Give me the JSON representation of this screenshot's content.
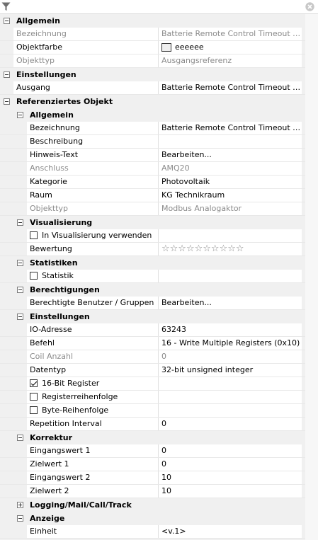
{
  "toolbar": {
    "filter_icon": "filter-icon",
    "clear_icon": "clear-icon"
  },
  "rows": [
    {
      "t": "sec",
      "level": 0,
      "name": "Allgemein"
    },
    {
      "t": "prop",
      "level": 0,
      "name": "Bezeichnung",
      "value": "Batterie Remote Control Timeout Ausgang",
      "disabled": true
    },
    {
      "t": "prop",
      "level": 0,
      "name": "Objektfarbe",
      "value": "eeeeee",
      "color": "#eeeeee"
    },
    {
      "t": "prop",
      "level": 0,
      "name": "Objekttyp",
      "value": "Ausgangsreferenz",
      "disabled": true
    },
    {
      "t": "sec",
      "level": 0,
      "name": "Einstellungen"
    },
    {
      "t": "prop",
      "level": 0,
      "name": "Ausgang",
      "value": "Batterie Remote Control Timeout Ausgang"
    },
    {
      "t": "sec",
      "level": 0,
      "name": "Referenziertes Objekt"
    },
    {
      "t": "sec",
      "level": 1,
      "name": "Allgemein"
    },
    {
      "t": "prop",
      "level": 1,
      "name": "Bezeichnung",
      "value": "Batterie Remote Control Timeout Ausgang"
    },
    {
      "t": "prop",
      "level": 1,
      "name": "Beschreibung",
      "value": ""
    },
    {
      "t": "prop",
      "level": 1,
      "name": "Hinweis-Text",
      "value": "Bearbeiten..."
    },
    {
      "t": "prop",
      "level": 1,
      "name": "Anschluss",
      "value": "AMQ20",
      "disabled": true
    },
    {
      "t": "prop",
      "level": 1,
      "name": "Kategorie",
      "value": "Photovoltaik"
    },
    {
      "t": "prop",
      "level": 1,
      "name": "Raum",
      "value": "KG Technikraum"
    },
    {
      "t": "prop",
      "level": 1,
      "name": "Objekttyp",
      "value": "Modbus Analogaktor",
      "disabled": true
    },
    {
      "t": "sec",
      "level": 1,
      "name": "Visualisierung"
    },
    {
      "t": "prop",
      "level": 1,
      "name": "In Visualisierung verwenden",
      "value": "",
      "checkbox": false
    },
    {
      "t": "prop",
      "level": 1,
      "name": "Bewertung",
      "value": "☆☆☆☆☆☆☆☆☆☆",
      "stars": true
    },
    {
      "t": "sec",
      "level": 1,
      "name": "Statistiken"
    },
    {
      "t": "prop",
      "level": 1,
      "name": "Statistik",
      "value": "",
      "checkbox": false
    },
    {
      "t": "sec",
      "level": 1,
      "name": "Berechtigungen"
    },
    {
      "t": "prop",
      "level": 1,
      "name": "Berechtigte Benutzer / Gruppen",
      "value": "Bearbeiten..."
    },
    {
      "t": "sec",
      "level": 1,
      "name": "Einstellungen"
    },
    {
      "t": "prop",
      "level": 1,
      "name": "IO-Adresse",
      "value": "63243"
    },
    {
      "t": "prop",
      "level": 1,
      "name": "Befehl",
      "value": "16 - Write Multiple Registers (0x10)"
    },
    {
      "t": "prop",
      "level": 1,
      "name": "Coil Anzahl",
      "value": "0",
      "disabled": true
    },
    {
      "t": "prop",
      "level": 1,
      "name": "Datentyp",
      "value": "32-bit unsigned integer"
    },
    {
      "t": "prop",
      "level": 1,
      "name": "16-Bit Register",
      "value": "",
      "checkbox": true
    },
    {
      "t": "prop",
      "level": 1,
      "name": "Registerreihenfolge",
      "value": "",
      "checkbox": false
    },
    {
      "t": "prop",
      "level": 1,
      "name": "Byte-Reihenfolge",
      "value": "",
      "checkbox": false
    },
    {
      "t": "prop",
      "level": 1,
      "name": "Repetition Interval",
      "value": "0"
    },
    {
      "t": "sec",
      "level": 1,
      "name": "Korrektur"
    },
    {
      "t": "prop",
      "level": 1,
      "name": "Eingangswert 1",
      "value": "0"
    },
    {
      "t": "prop",
      "level": 1,
      "name": "Zielwert 1",
      "value": "0"
    },
    {
      "t": "prop",
      "level": 1,
      "name": "Eingangswert 2",
      "value": "10"
    },
    {
      "t": "prop",
      "level": 1,
      "name": "Zielwert 2",
      "value": "10"
    },
    {
      "t": "sec",
      "level": 1,
      "name": "Logging/Mail/Call/Track",
      "collapsed": true
    },
    {
      "t": "sec",
      "level": 1,
      "name": "Anzeige"
    },
    {
      "t": "prop",
      "level": 1,
      "name": "Einheit",
      "value": "<v.1>"
    }
  ]
}
